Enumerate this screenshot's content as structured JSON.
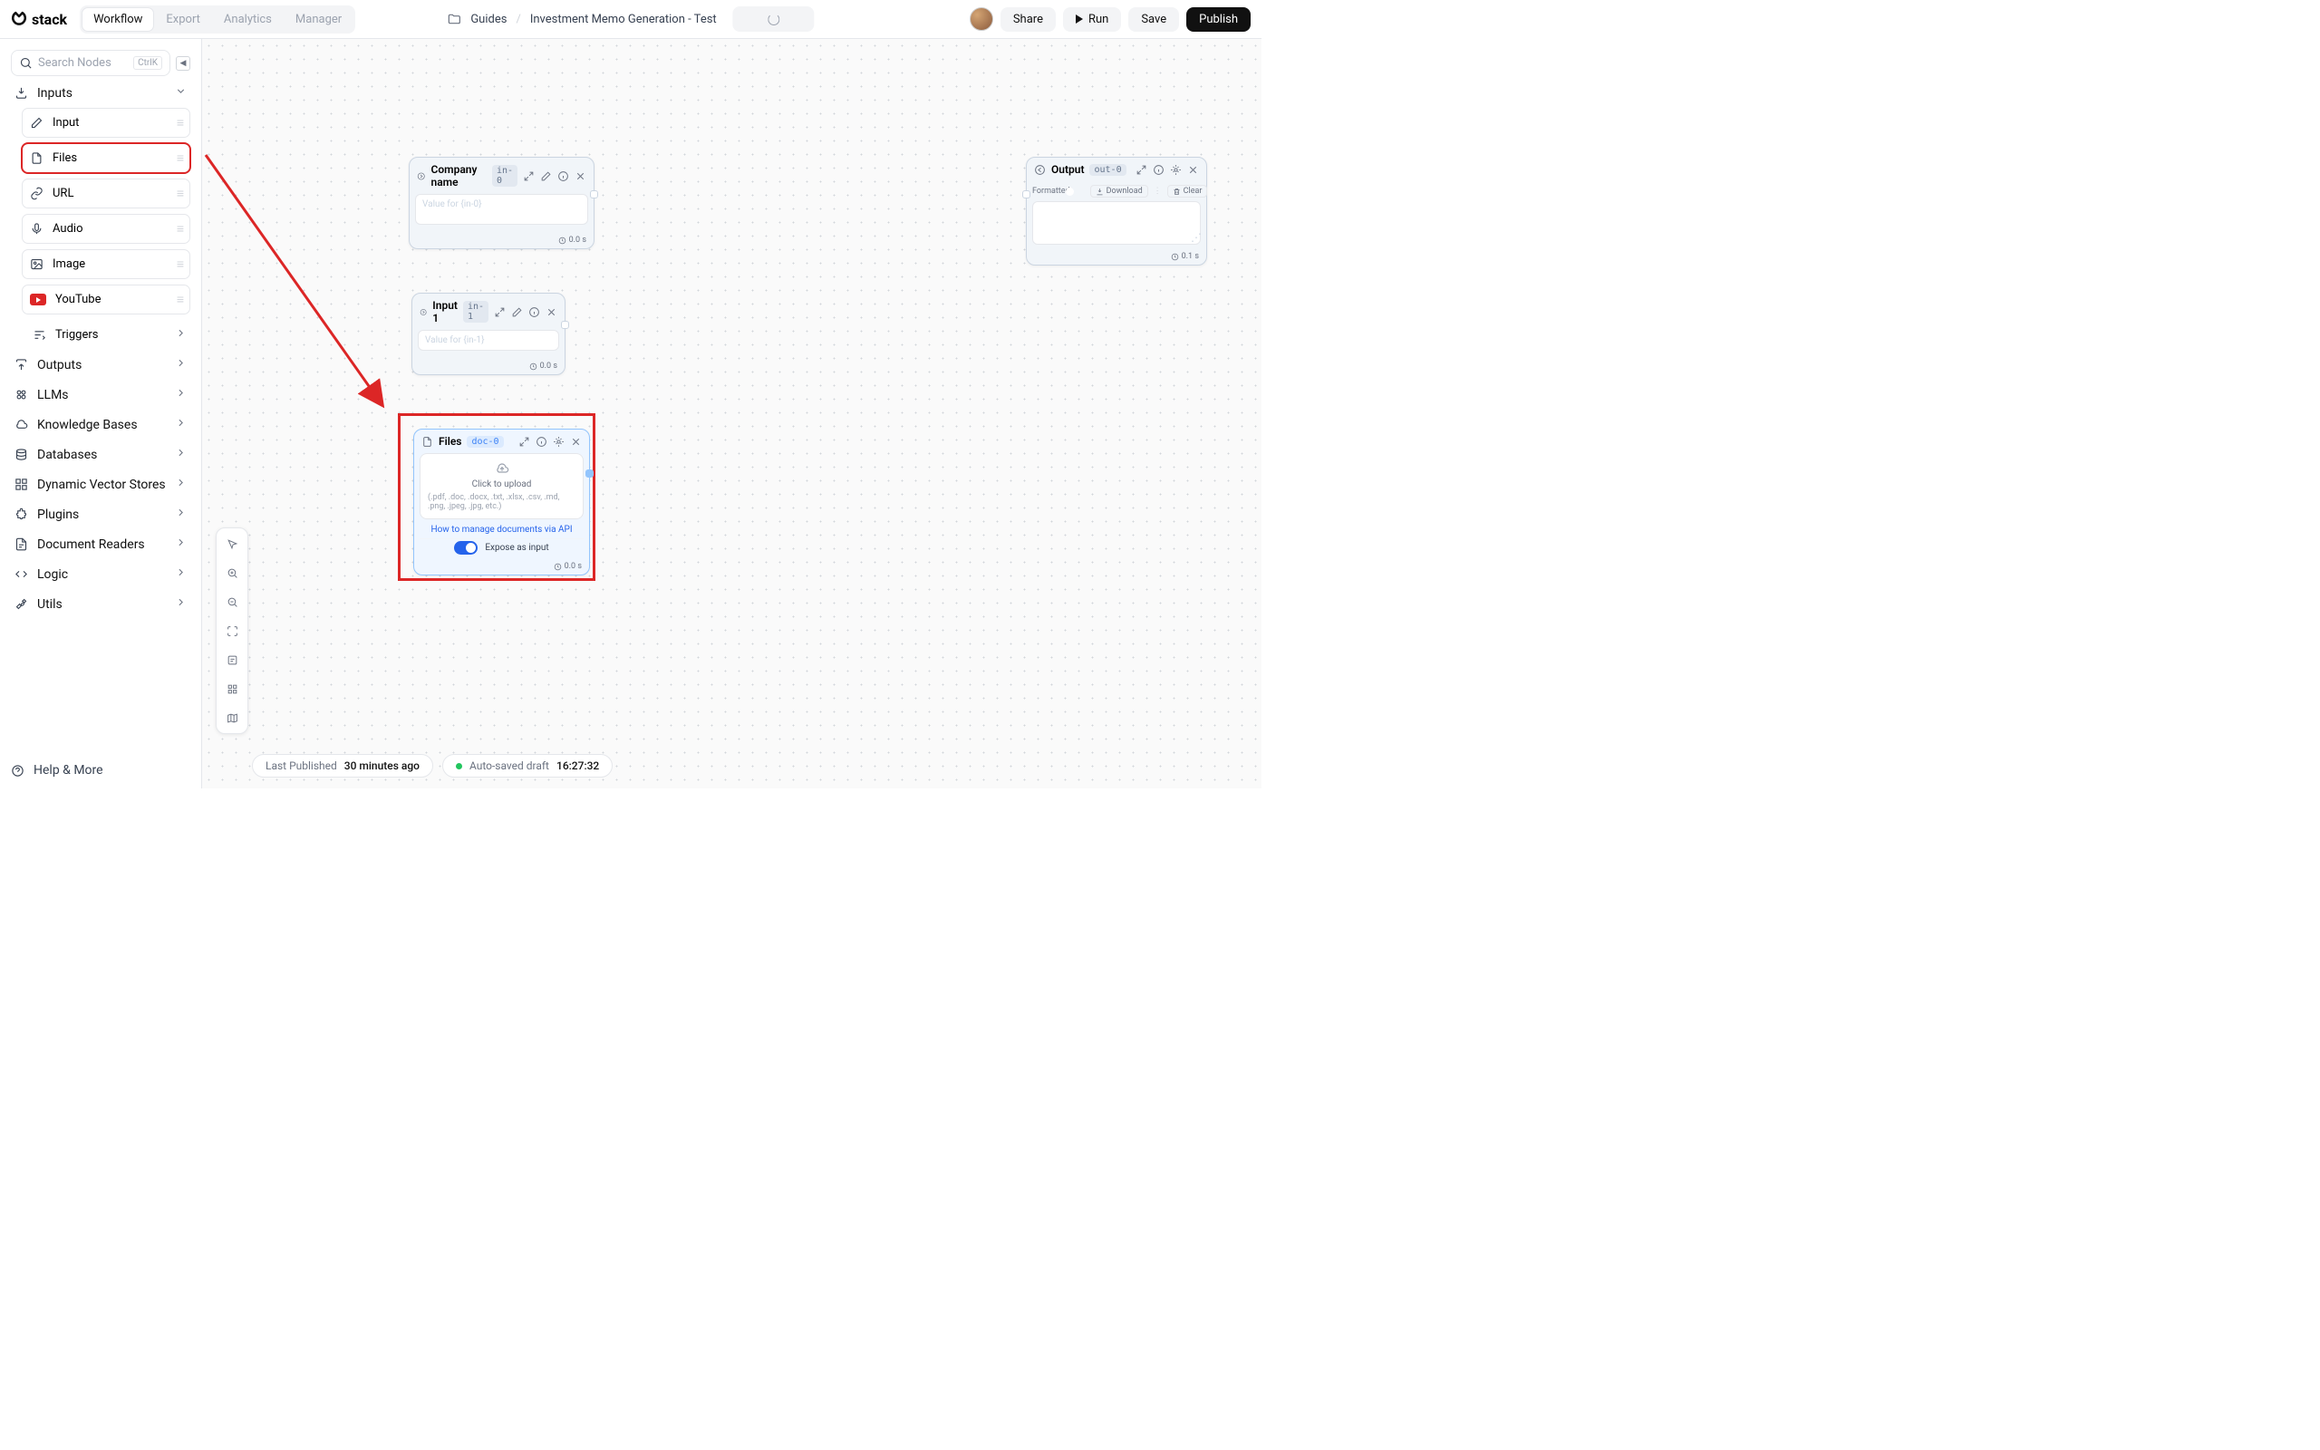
{
  "logo": "stack",
  "tabs": [
    "Workflow",
    "Export",
    "Analytics",
    "Manager"
  ],
  "breadcrumb": {
    "folder": "Guides",
    "file": "Investment Memo Generation - Test"
  },
  "buttons": {
    "share": "Share",
    "run": "Run",
    "save": "Save",
    "publish": "Publish"
  },
  "search": {
    "placeholder": "Search Nodes",
    "kbd": "CtrlK"
  },
  "sidebar": {
    "inputs_label": "Inputs",
    "items": [
      "Input",
      "Files",
      "URL",
      "Audio",
      "Image",
      "YouTube"
    ],
    "triggers": "Triggers",
    "cats": [
      "Outputs",
      "LLMs",
      "Knowledge Bases",
      "Databases",
      "Dynamic Vector Stores",
      "Plugins",
      "Document Readers",
      "Logic",
      "Utils"
    ],
    "help": "Help & More"
  },
  "nodes": {
    "company": {
      "title": "Company name",
      "badge": "in-0",
      "placeholder": "Value for {in-0}",
      "time": "0.0 s"
    },
    "input1": {
      "title": "Input 1",
      "badge": "in-1",
      "placeholder": "Value for {in-1}",
      "time": "0.0 s"
    },
    "files": {
      "title": "Files",
      "badge": "doc-0",
      "upload": "Click to upload",
      "formats": "(.pdf, .doc, .docx, .txt, .xlsx, .csv, .md, .png, .jpeg, .jpg, etc.)",
      "api": "How to manage documents via API",
      "expose": "Expose as input",
      "time": "0.0 s"
    },
    "output": {
      "title": "Output",
      "badge": "out-0",
      "formatted": "Formatted",
      "download": "Download",
      "clear": "Clear",
      "time": "0.1 s"
    }
  },
  "status": {
    "pub_label": "Last Published",
    "pub_time": "30 minutes ago",
    "auto_label": "Auto-saved draft",
    "auto_time": "16:27:32"
  }
}
